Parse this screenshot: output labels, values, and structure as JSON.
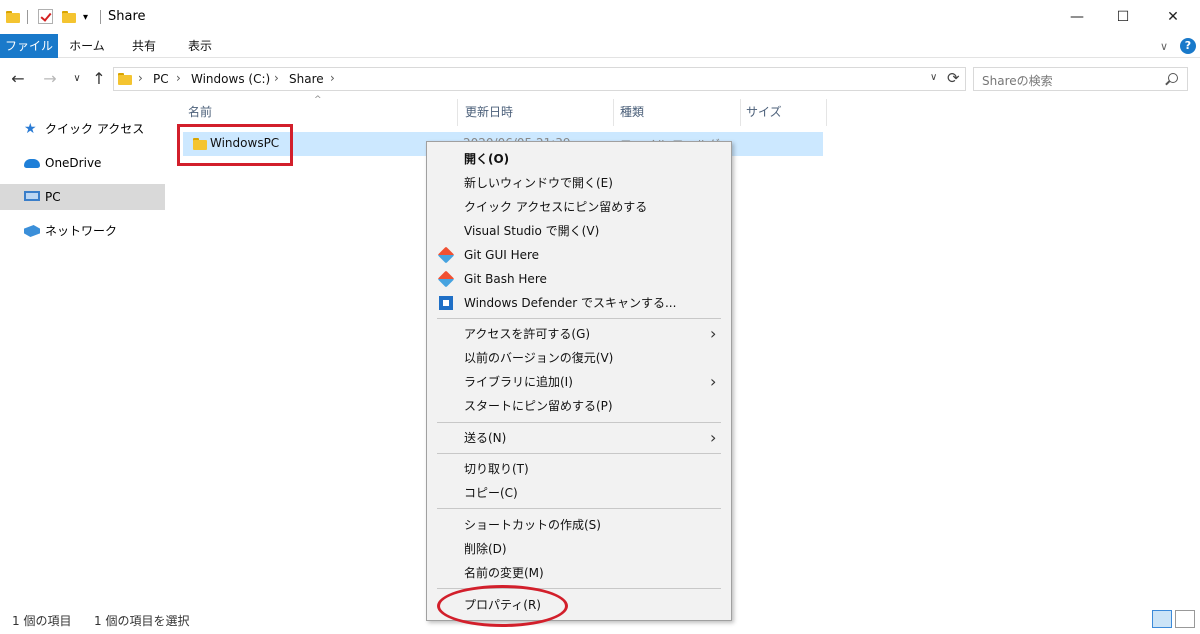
{
  "window": {
    "title": "Share",
    "minimize": "—",
    "maximize": "☐",
    "close": "✕"
  },
  "ribbon": {
    "tabs": [
      "ファイル",
      "ホーム",
      "共有",
      "表示"
    ],
    "help": "?",
    "expand": "∨"
  },
  "address": {
    "back": "←",
    "forward": "→",
    "recent": "∨",
    "up": "↑",
    "crumbs": [
      "PC",
      "Windows (C:)",
      "Share"
    ],
    "crumb_sep": "›",
    "dropdown": "∨",
    "refresh": "⟳"
  },
  "search": {
    "placeholder": "Shareの検索"
  },
  "nav": {
    "items": [
      {
        "label": "クイック アクセス",
        "icon": "star-icon"
      },
      {
        "label": "OneDrive",
        "icon": "cloud-icon"
      },
      {
        "label": "PC",
        "icon": "pc-icon"
      },
      {
        "label": "ネットワーク",
        "icon": "network-icon"
      }
    ]
  },
  "columns": {
    "name": "名前",
    "date": "更新日時",
    "type": "種類",
    "size": "サイズ",
    "sort_indicator": "^"
  },
  "files": [
    {
      "name": "WindowsPC",
      "date": "2020/06/05 21:39",
      "type": "ファイル フォルダー",
      "size": ""
    }
  ],
  "context_menu": {
    "items": [
      {
        "label": "開く(O)"
      },
      {
        "label": "新しいウィンドウで開く(E)"
      },
      {
        "label": "クイック アクセスにピン留めする"
      },
      {
        "label": "Visual Studio で開く(V)"
      },
      {
        "label": "Git GUI Here"
      },
      {
        "label": "Git Bash Here"
      },
      {
        "label": "Windows Defender でスキャンする..."
      },
      {
        "label": "アクセスを許可する(G)"
      },
      {
        "label": "以前のバージョンの復元(V)"
      },
      {
        "label": "ライブラリに追加(I)"
      },
      {
        "label": "スタートにピン留めする(P)"
      },
      {
        "label": "送る(N)"
      },
      {
        "label": "切り取り(T)"
      },
      {
        "label": "コピー(C)"
      },
      {
        "label": "ショートカットの作成(S)"
      },
      {
        "label": "削除(D)"
      },
      {
        "label": "名前の変更(M)"
      },
      {
        "label": "プロパティ(R)"
      }
    ],
    "submenu_arrow": "›"
  },
  "status": {
    "count": "1 個の項目",
    "selected": "1 個の項目を選択"
  },
  "colors": {
    "accent": "#1979ca",
    "selection": "#cce8ff",
    "highlight": "#d21f2b"
  }
}
